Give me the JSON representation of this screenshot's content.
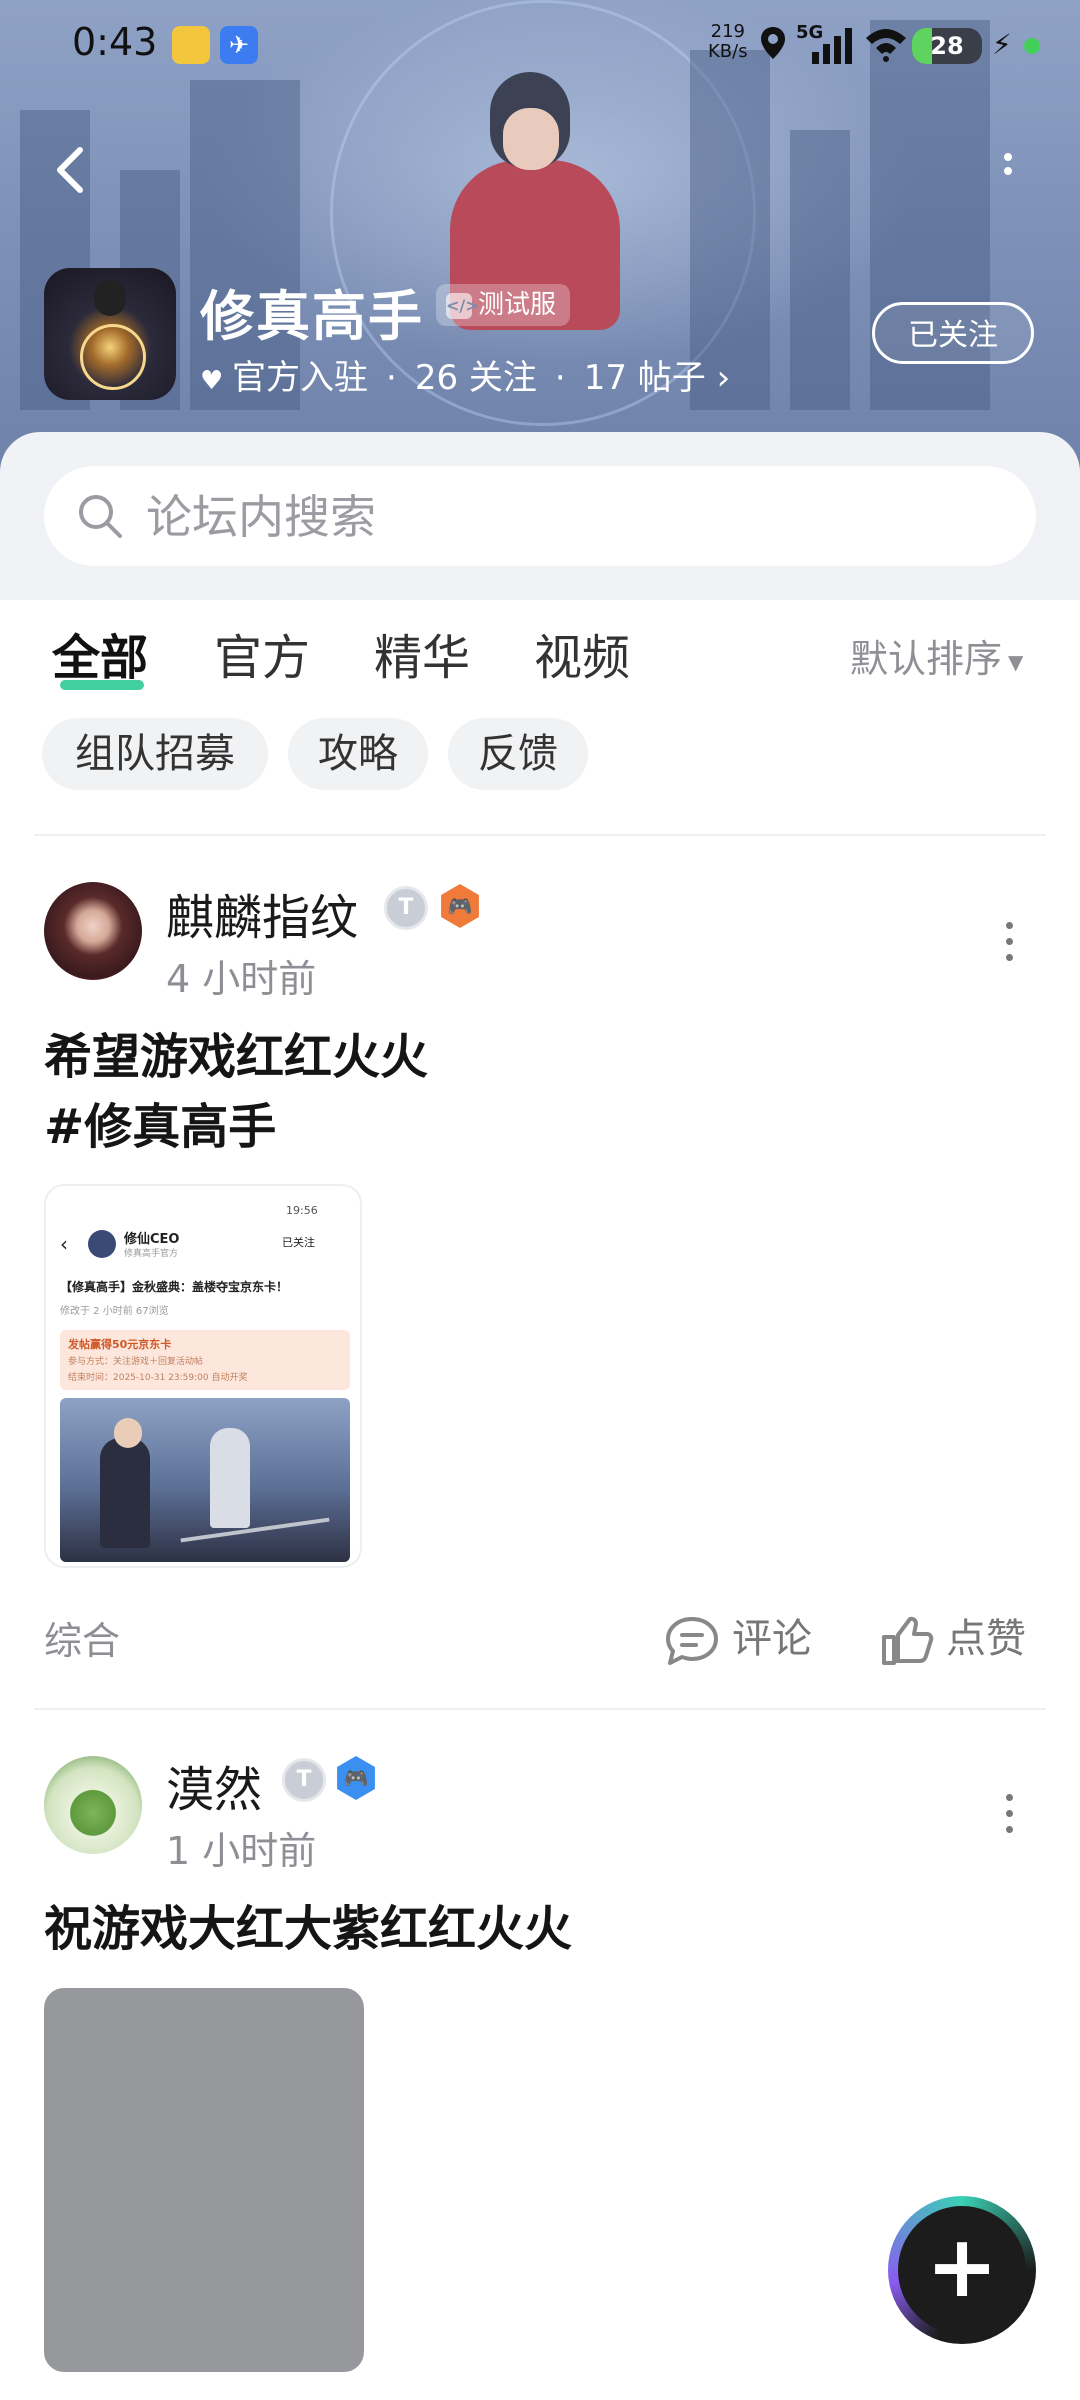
{
  "status_bar": {
    "time": "0:43",
    "speed_value": "219",
    "speed_unit": "KB/s",
    "network": "5G",
    "battery": "28"
  },
  "header": {
    "game_name": "修真高手",
    "badge": "测试服",
    "official_label": "官方入驻",
    "following": "26 关注",
    "posts": "17 帖子",
    "follow_button": "已关注"
  },
  "search": {
    "placeholder": "论坛内搜索"
  },
  "tabs": [
    {
      "label": "全部",
      "active": true
    },
    {
      "label": "官方",
      "active": false
    },
    {
      "label": "精华",
      "active": false
    },
    {
      "label": "视频",
      "active": false
    }
  ],
  "sort": {
    "label": "默认排序"
  },
  "chips": [
    "组队招募",
    "攻略",
    "反馈"
  ],
  "posts": [
    {
      "author": "麒麟指纹",
      "time": "4 小时前",
      "title_line1": "希望游戏红红火火",
      "title_line2": "#修真高手",
      "category": "综合",
      "comment_label": "评论",
      "like_label": "点赞",
      "thumbnail": {
        "status_time": "19:56",
        "account": "修仙CEO",
        "account_sub": "修真高手官方",
        "follow": "已关注",
        "headline": "【修真高手】金秋盛典：盖楼夺宝京东卡！",
        "edited": "修改于 2 小时前  67浏览",
        "gift_title": "发帖赢得50元京东卡",
        "gift_way": "参与方式：关注游戏＋回复活动帖",
        "gift_end": "结束时间：2025-10-31 23:59:00 自动开奖"
      }
    },
    {
      "author": "漠然",
      "time": "1 小时前",
      "title_line1": "祝游戏大红大紫红红火火"
    }
  ],
  "colors": {
    "accent": "#42cfa0",
    "hero": "#7f92b8",
    "role_orange": "#f07a3a",
    "role_blue": "#3a8ff0"
  },
  "icons": {
    "back": "chevron-left-icon",
    "more": "more-vertical-icon",
    "search": "search-icon",
    "comment": "comment-icon",
    "like": "thumbs-up-icon",
    "add": "plus-icon"
  }
}
